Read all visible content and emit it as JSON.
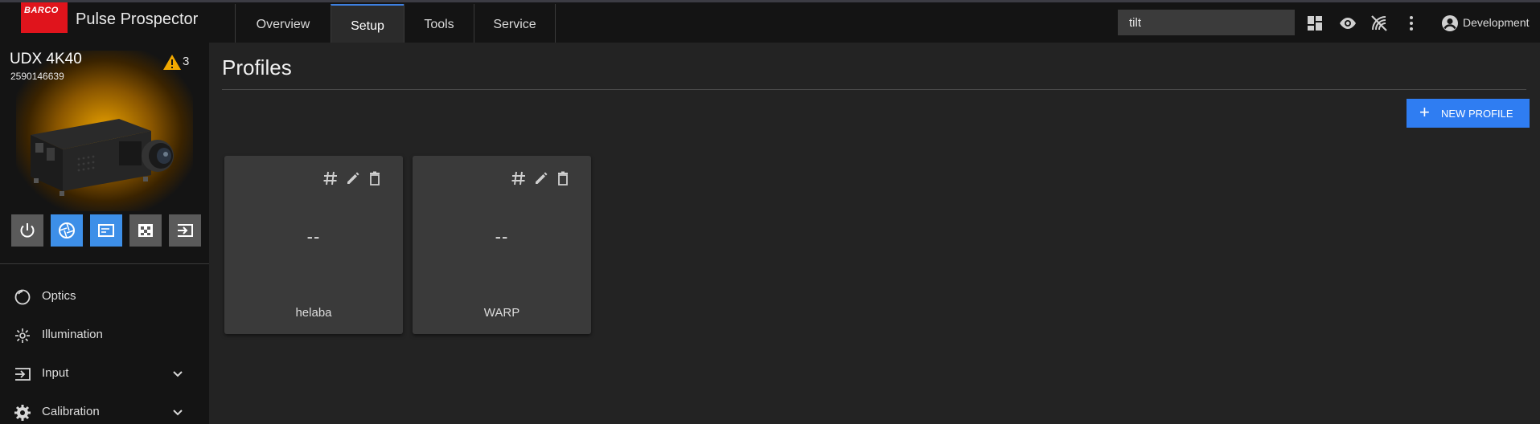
{
  "app": {
    "brand": "BARCO",
    "title": "Pulse Prospector"
  },
  "nav": {
    "tabs": [
      {
        "label": "Overview"
      },
      {
        "label": "Setup"
      },
      {
        "label": "Tools"
      },
      {
        "label": "Service"
      }
    ],
    "active": "Setup"
  },
  "search": {
    "value": "tilt"
  },
  "toolbar": {
    "icons": [
      "dashboard-icon",
      "eye-icon",
      "no-signal-icon",
      "more-vert-icon"
    ]
  },
  "user": {
    "label": "Development",
    "icon": "account-circle-icon"
  },
  "device": {
    "name": "UDX 4K40",
    "serial": "2590146639",
    "warning_count": "3"
  },
  "controls": [
    {
      "name": "power-icon",
      "color": "#5a5a5a"
    },
    {
      "name": "shutter-icon",
      "color": "#3d8fe8"
    },
    {
      "name": "osd-icon",
      "color": "#3d8fe8"
    },
    {
      "name": "test-pattern-icon",
      "color": "#5a5a5a"
    },
    {
      "name": "input-icon",
      "color": "#5a5a5a"
    }
  ],
  "sidebar": {
    "items": [
      {
        "label": "Optics",
        "icon": "optics-icon"
      },
      {
        "label": "Illumination",
        "icon": "illumination-icon"
      },
      {
        "label": "Input",
        "icon": "input-icon",
        "expandable": true
      },
      {
        "label": "Calibration",
        "icon": "gear-icon",
        "expandable": true
      }
    ]
  },
  "main": {
    "title": "Profiles",
    "new_button": "NEW PROFILE",
    "profiles": [
      {
        "value": "--",
        "name": "helaba"
      },
      {
        "value": "--",
        "name": "WARP"
      }
    ]
  },
  "colors": {
    "accent": "#2f7df2",
    "brand": "#e0141c",
    "warning": "#f2a900"
  }
}
